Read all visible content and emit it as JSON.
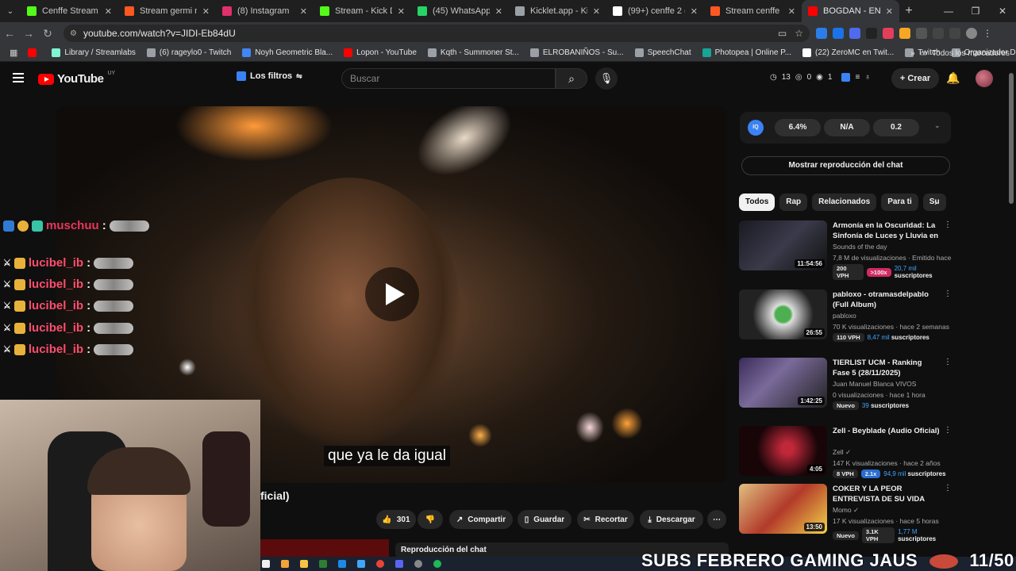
{
  "browser": {
    "tabs": [
      {
        "title": "Cenffe Stream - Watc",
        "color": "#53fc18"
      },
      {
        "title": "Stream germi music |",
        "color": "#ff5722"
      },
      {
        "title": "(8) Instagram",
        "color": "#e1306c"
      },
      {
        "title": "Stream - Kick Dashbo",
        "color": "#53fc18"
      },
      {
        "title": "(45) WhatsApp",
        "color": "#25d366"
      },
      {
        "title": "Kicklet.app - Kick Ch",
        "color": "#9aa0a6"
      },
      {
        "title": "(99+) cenffe 2 (@cenf",
        "color": "#ffffff"
      },
      {
        "title": "Stream cenffe music",
        "color": "#ff5722"
      },
      {
        "title": "BOGDAN - ENGA",
        "color": "#ff0000"
      }
    ],
    "url": "youtube.com/watch?v=JIDI-Eb84dU",
    "bookmarks": [
      {
        "label": "",
        "color": "#ff0000"
      },
      {
        "label": "Library / Streamlabs",
        "color": "#80f5d2"
      },
      {
        "label": "(6) rageylo0 - Twitch",
        "color": "#9aa0a6"
      },
      {
        "label": "Noyh Geometric Bla...",
        "color": "#4285f4"
      },
      {
        "label": "Lopon - YouTube",
        "color": "#ff0000"
      },
      {
        "label": "Kqth - Summoner St...",
        "color": "#9aa0a6"
      },
      {
        "label": "ELROBANIÑOS - Su...",
        "color": "#9aa0a6"
      },
      {
        "label": "SpeechChat",
        "color": "#9aa0a6"
      },
      {
        "label": "Photopea | Online P...",
        "color": "#18a497"
      },
      {
        "label": "(22) ZeroMC en Twit...",
        "color": "#ffffff"
      },
      {
        "label": "Twitch",
        "color": "#9aa0a6"
      },
      {
        "label": "Organizador De Zap...",
        "color": "#9aa0a6"
      }
    ],
    "bookmarks_all": "Todos los marcadores"
  },
  "youtube": {
    "logo": "YouTube",
    "region": "UY",
    "filters": "Los filtros",
    "search_placeholder": "Buscar",
    "stats": {
      "a": "13",
      "b": "0",
      "c": "1"
    },
    "create": "Crear",
    "caption": "que ya le da igual",
    "title_fragment": "ficial)",
    "actions": {
      "likes": "301",
      "share": "Compartir",
      "save": "Guardar",
      "clip": "Recortar",
      "download": "Descargar"
    },
    "chat_replay": "Reproducción del chat",
    "iq": {
      "label": "IQ",
      "v1": "6.4%",
      "v2": "N/A",
      "v3": "0.2"
    },
    "show_chat": "Mostrar reproducción del chat",
    "chips": [
      "Todos",
      "Rap",
      "Relacionados",
      "Para ti",
      "Su"
    ],
    "recommendations": [
      {
        "title": "Armonía en la Oscuridad: La Sinfonía de Luces y Lluvia en l...",
        "channel": "Sounds of the day",
        "meta": "7,8 M de visualizaciones · Emitido hace ...",
        "duration": "11:54:56",
        "vph": "200 VPH",
        "extra": ">100x",
        "subs_num": "20,7 mil",
        "subs_label": "suscriptores"
      },
      {
        "title": "pabloxo - otramasdelpablo (Full Album)",
        "channel": "pabloxo",
        "meta": "70 K visualizaciones · hace 2 semanas",
        "duration": "26:55",
        "vph": "110 VPH",
        "extra": "",
        "subs_num": "8,47 mil",
        "subs_label": "suscriptores"
      },
      {
        "title": "TIERLIST UCM - Ranking Fase 5 (28/11/2025)",
        "channel": "Juan Manuel Blanca VIVOS",
        "meta": "0 visualizaciones · hace 1 hora",
        "duration": "1:42:25",
        "vph": "Nuevo",
        "extra": "",
        "subs_num": "39",
        "subs_label": "suscriptores"
      },
      {
        "title": "Zell - Beyblade (Audio Oficial)",
        "channel": "Zell ✓",
        "meta": "147 K visualizaciones · hace 2 años",
        "duration": "4:05",
        "vph": "8 VPH",
        "extra": "2.1x",
        "subs_num": "94,9 mil",
        "subs_label": "suscriptores"
      },
      {
        "title": "COKER Y LA PEOR ENTREVISTA DE SU VIDA",
        "channel": "Momo ✓",
        "meta": "17 K visualizaciones · hace 5 horas",
        "duration": "13:50",
        "vph": "Nuevo",
        "extra": "3.1K VPH",
        "subs_num": "1,77 M",
        "subs_label": "suscriptores"
      }
    ]
  },
  "stream_overlay": {
    "chat": [
      {
        "user": "muschuu",
        "color": "#e8365d"
      },
      {
        "user": "lucibel_ib",
        "color": "#ff4d6d"
      },
      {
        "user": "lucibel_ib",
        "color": "#ff4d6d"
      },
      {
        "user": "lucibel_ib",
        "color": "#ff4d6d"
      },
      {
        "user": "lucibel_ib",
        "color": "#ff4d6d"
      },
      {
        "user": "lucibel_ib",
        "color": "#ff4d6d"
      }
    ],
    "banner": "SUBS FEBRERO GAMING JAUS",
    "counter": "11/50"
  }
}
